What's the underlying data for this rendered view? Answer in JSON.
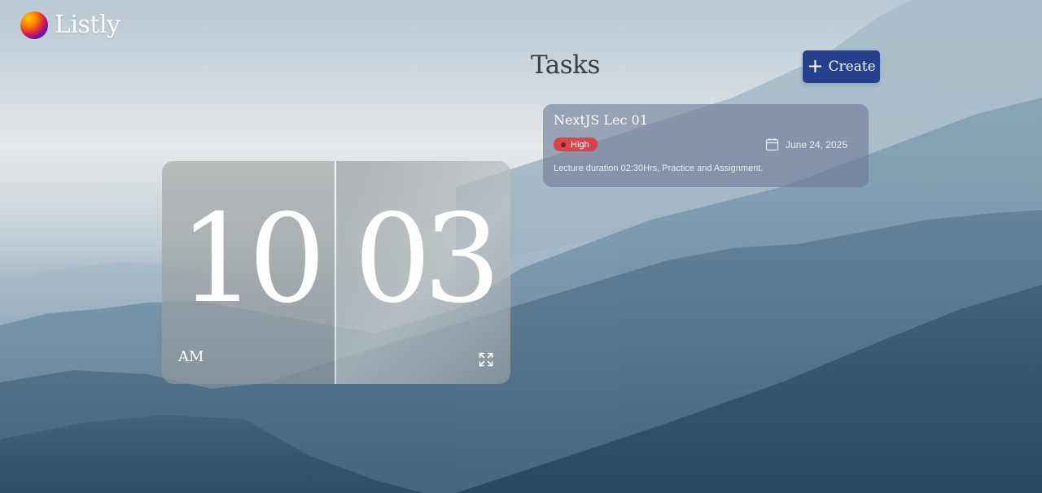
{
  "app": {
    "brand_name": "Listly",
    "logo_icon": "orb-logo-icon"
  },
  "header": {
    "title": "Tasks",
    "create_button": {
      "label": "Create",
      "icon": "plus-icon",
      "color": "#25418d"
    }
  },
  "tasks": [
    {
      "title": "NextJS Lec 01",
      "priority": "High",
      "priority_color": "#d9454e",
      "date": "June 24, 2025",
      "date_icon": "calendar-icon",
      "description": "Lecture duration 02:30Hrs, Practice and Assignment."
    }
  ],
  "clock": {
    "hours": "10",
    "minutes": "03",
    "period": "AM",
    "expand_icon": "expand-icon"
  }
}
